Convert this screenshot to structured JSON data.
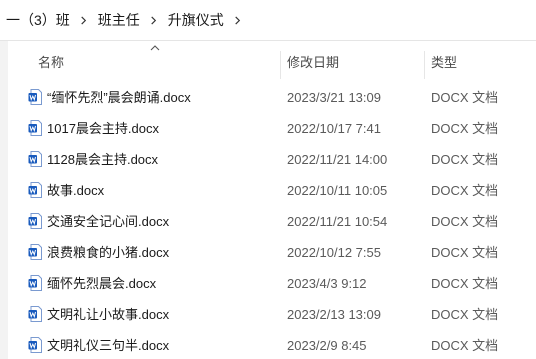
{
  "breadcrumb": {
    "items": [
      "一（3）班",
      "班主任",
      "升旗仪式"
    ]
  },
  "columns": {
    "name": "名称",
    "date_modified": "修改日期",
    "type": "类型",
    "sort_indicator": "sort-ascending-icon"
  },
  "files": [
    {
      "name": "“缅怀先烈”晨会朗诵.docx",
      "date": "2023/3/21 13:09",
      "type": "DOCX 文档"
    },
    {
      "name": "1017晨会主持.docx",
      "date": "2022/10/17 7:41",
      "type": "DOCX 文档"
    },
    {
      "name": "1128晨会主持.docx",
      "date": "2022/11/21 14:00",
      "type": "DOCX 文档"
    },
    {
      "name": "故事.docx",
      "date": "2022/10/11 10:05",
      "type": "DOCX 文档"
    },
    {
      "name": "交通安全记心间.docx",
      "date": "2022/11/21 10:54",
      "type": "DOCX 文档"
    },
    {
      "name": "浪费粮食的小猪.docx",
      "date": "2022/10/12 7:55",
      "type": "DOCX 文档"
    },
    {
      "name": "缅怀先烈晨会.docx",
      "date": "2023/4/3 9:12",
      "type": "DOCX 文档"
    },
    {
      "name": "文明礼让小故事.docx",
      "date": "2023/2/13 13:09",
      "type": "DOCX 文档"
    },
    {
      "name": "文明礼仪三句半.docx",
      "date": "2023/2/9 8:45",
      "type": "DOCX 文档"
    }
  ],
  "colors": {
    "word_icon_blue": "#185abd",
    "word_page": "#ffffff",
    "header_text": "#4a4a4a"
  }
}
